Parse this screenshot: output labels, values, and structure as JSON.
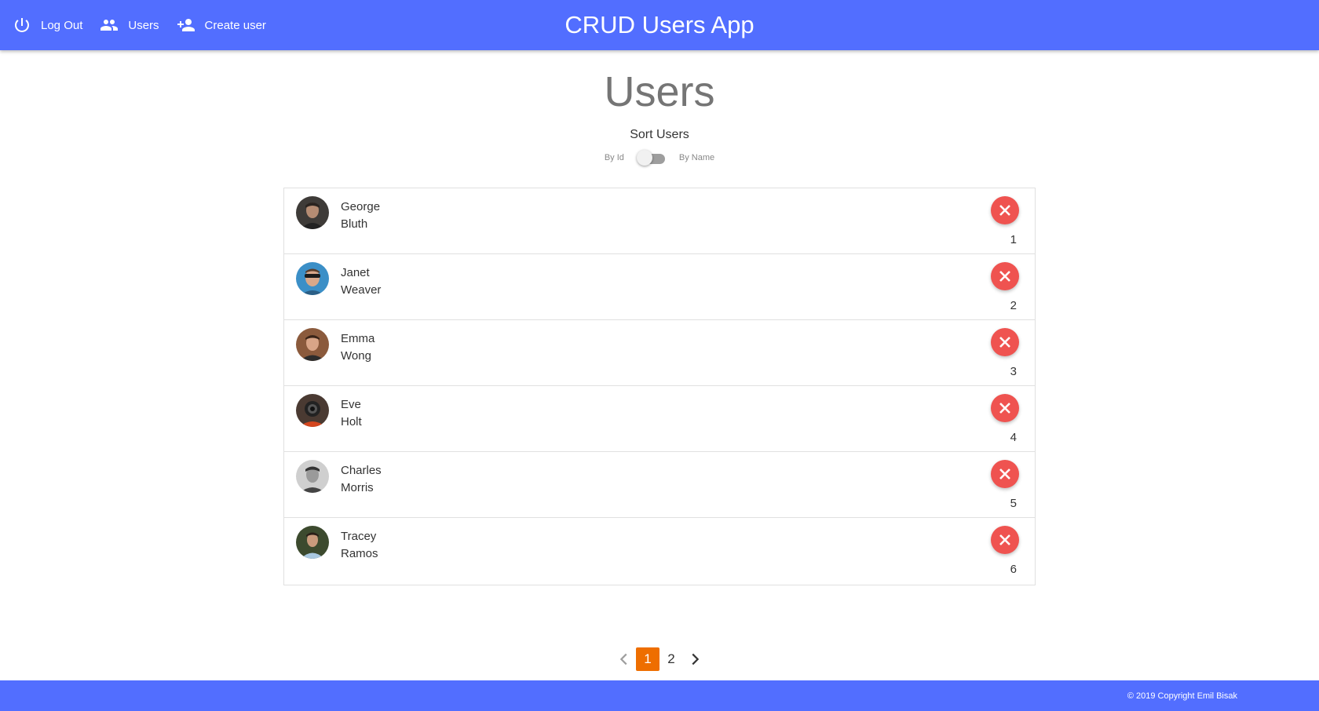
{
  "header": {
    "title": "CRUD Users App",
    "nav": [
      {
        "label": "Log Out",
        "icon": "power-icon"
      },
      {
        "label": "Users",
        "icon": "users-icon"
      },
      {
        "label": "Create user",
        "icon": "add-user-icon"
      }
    ]
  },
  "main": {
    "title": "Users",
    "sort": {
      "title": "Sort Users",
      "left_label": "By Id",
      "right_label": "By Name",
      "by_name_enabled": false
    },
    "users": [
      {
        "first": "George",
        "last": "Bluth",
        "id": "1"
      },
      {
        "first": "Janet",
        "last": "Weaver",
        "id": "2"
      },
      {
        "first": "Emma",
        "last": "Wong",
        "id": "3"
      },
      {
        "first": "Eve",
        "last": "Holt",
        "id": "4"
      },
      {
        "first": "Charles",
        "last": "Morris",
        "id": "5"
      },
      {
        "first": "Tracey",
        "last": "Ramos",
        "id": "6"
      }
    ]
  },
  "pagination": {
    "pages": [
      "1",
      "2"
    ],
    "current": "1"
  },
  "footer": {
    "copyright": "© 2019 Copyright Emil Bisak"
  },
  "colors": {
    "primary": "#526eff",
    "danger": "#ef5350",
    "active_page": "#ee6e00"
  }
}
